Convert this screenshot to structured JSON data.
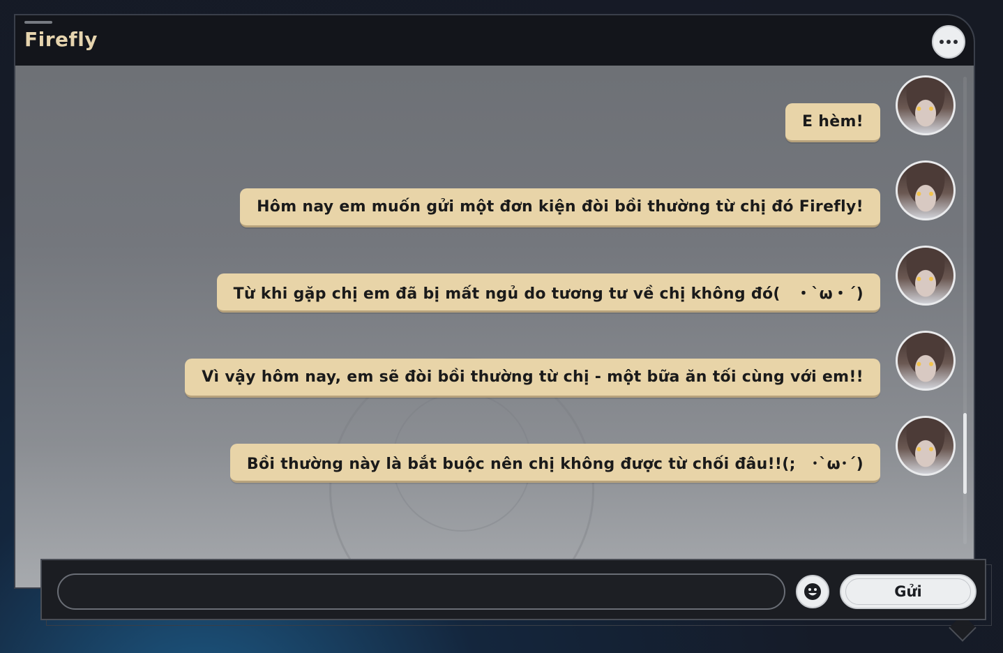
{
  "header": {
    "title": "Firefly",
    "more_icon": "ellipsis-icon"
  },
  "messages": [
    {
      "text": "E hèm!"
    },
    {
      "text": "Hôm nay em muốn gửi một đơn kiện đòi bồi thường từ chị đó Firefly!"
    },
    {
      "text": "Từ khi gặp chị em đã bị mất ngủ do tương tư về chị không đó(　・`ω・´)"
    },
    {
      "text": "Vì vậy hôm nay, em sẽ đòi bồi thường từ chị - một bữa ăn tối cùng với em!!"
    },
    {
      "text": "Bồi thường này là bắt buộc nên chị không được từ chối đâu!!(;　･`ω･´)"
    }
  ],
  "composer": {
    "input_value": "",
    "input_placeholder": "",
    "emoji_icon": "smiley-face-icon",
    "send_label": "Gửi"
  },
  "colors": {
    "bubble": "#e8d4a8",
    "title": "#e6d4ae",
    "header_bg": "#13151b"
  }
}
